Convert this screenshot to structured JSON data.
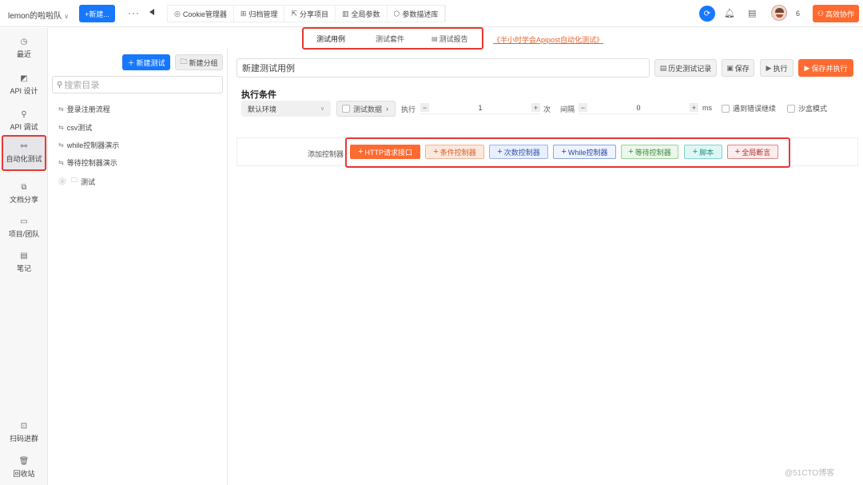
{
  "topbar": {
    "team": "lemon的啦啦队",
    "new_button": "+新建...",
    "more": "···",
    "menu": [
      {
        "icon": "cookie-icon",
        "label": "Cookie管理器"
      },
      {
        "icon": "archive-icon",
        "label": "归档管理"
      },
      {
        "icon": "share-icon",
        "label": "分享项目"
      },
      {
        "icon": "params-icon",
        "label": "全局参数"
      },
      {
        "icon": "cube-icon",
        "label": "参数描述库"
      }
    ],
    "member_count": "6",
    "collab_button": "高效协作"
  },
  "sidebar": {
    "items": [
      {
        "icon": "clock-icon",
        "label": "最近"
      },
      {
        "icon": "api-design-icon",
        "label": "API 设计"
      },
      {
        "icon": "api-debug-icon",
        "label": "API 调试"
      },
      {
        "icon": "automation-icon",
        "label": "自动化测试"
      },
      {
        "icon": "doc-share-icon",
        "label": "文档分享"
      },
      {
        "icon": "team-icon",
        "label": "项目/团队"
      },
      {
        "icon": "note-icon",
        "label": "笔记"
      }
    ],
    "bottom": [
      {
        "icon": "qrcode-icon",
        "label": "扫码进群"
      },
      {
        "icon": "trash-icon",
        "label": "回收站"
      }
    ]
  },
  "tree": {
    "new_test": "新建测试",
    "new_group": "新建分组",
    "search_placeholder": "搜索目录",
    "items": [
      "登录注册流程",
      "csv测试",
      "while控制器演示",
      "等待控制器演示",
      "测试"
    ]
  },
  "tabs": [
    "测试用例",
    "测试套件",
    "测试报告"
  ],
  "promo_link": "《半小时学会Apipost自动化测试》",
  "editor": {
    "title_value": "新建测试用例",
    "history": "历史测试记录",
    "save": "保存",
    "run": "执行",
    "save_run": "保存并执行"
  },
  "conditions": {
    "title": "执行条件",
    "environment": "默认环境",
    "test_data": "测试数据",
    "exec_label": "执行",
    "exec_value": "1",
    "times_unit": "次",
    "interval_label": "间隔",
    "interval_value": "0",
    "ms_unit": "ms",
    "continue_on_error": "遇到错误继续",
    "sandbox": "沙盒模式"
  },
  "controllers": {
    "label": "添加控制器",
    "buttons": [
      "HTTP请求接口",
      "条件控制器",
      "次数控制器",
      "While控制器",
      "等待控制器",
      "脚本",
      "全局断言"
    ]
  },
  "watermark": "@51CTO博客",
  "colors": {
    "primary": "#1677ff",
    "accent": "#ff6a30",
    "highlight_border": "#e53935"
  }
}
